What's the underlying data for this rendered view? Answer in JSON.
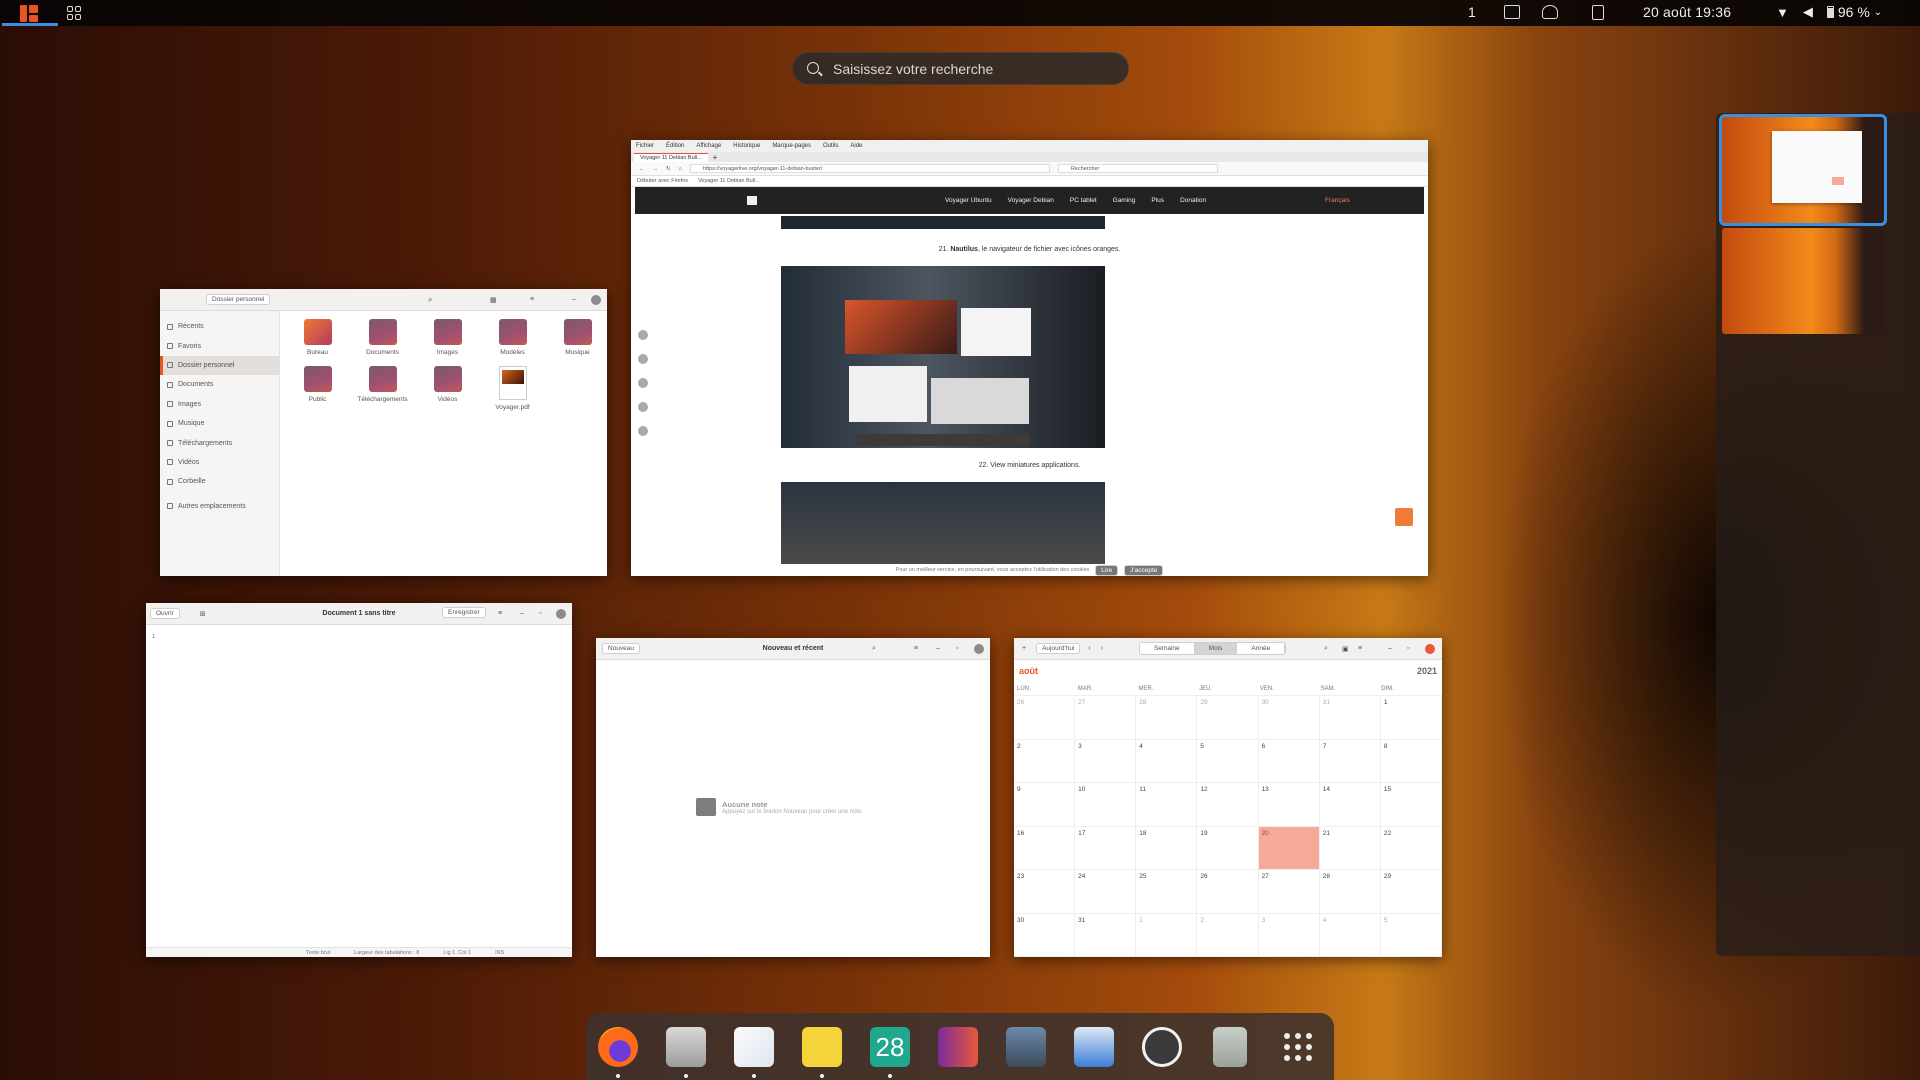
{
  "topbar": {
    "workspace_number": "1",
    "clock": "20 août 19:36",
    "battery": "96 %"
  },
  "search": {
    "placeholder": "Saisissez votre recherche"
  },
  "files_window": {
    "path": "Dossier personnel",
    "sidebar": [
      "Récents",
      "Favoris",
      "Dossier personnel",
      "Documents",
      "Images",
      "Musique",
      "Téléchargements",
      "Vidéos",
      "Corbeille",
      "Autres emplacements"
    ],
    "items": [
      "Bureau",
      "Documents",
      "Images",
      "Modèles",
      "Musique",
      "Public",
      "Téléchargements",
      "Vidéos",
      "Voyager.pdf"
    ]
  },
  "firefox_window": {
    "menu": [
      "Fichier",
      "Édition",
      "Affichage",
      "Historique",
      "Marque-pages",
      "Outils",
      "Aide"
    ],
    "tab_title": "Voyager 11 Debian Bull...",
    "url": "https://voyagerlive.org/voyager-11-debian-buster/",
    "search_placeholder": "Rechercher",
    "bookmarks": [
      "Débuter avec Firefox",
      "Voyager 11 Debian Bull..."
    ],
    "site_nav": [
      "Voyager Ubuntu",
      "Voyager Debian",
      "PC tablet",
      "Gaming",
      "Plus",
      "Donation"
    ],
    "language": "Français",
    "caption_21_num": "21.",
    "caption_21_bold": "Nautilus",
    "caption_21_rest": ", le navigateur de fichier avec icônes oranges.",
    "caption_22": "22. View miniatures applications.",
    "cookie_text": "Pour un meilleur service, en poursuivant, vous acceptez l'utilisation des cookies",
    "cookie_ok": "Lire",
    "cookie_accept": "J'accepte"
  },
  "editor_window": {
    "open_label": "Ouvrir",
    "title": "Document 1 sans titre",
    "save_label": "Enregistrer",
    "line_number": "1",
    "status": [
      "Texte brut",
      "Largeur des tabulations : 8",
      "Lig 1, Col 1",
      "INS"
    ]
  },
  "notes_window": {
    "new_label": "Nouveau",
    "title": "Nouveau et récent",
    "empty_title": "Aucune note",
    "empty_hint": "Appuyez sur le bouton Nouveau pour créer une note."
  },
  "calendar_window": {
    "today_label": "Aujourd'hui",
    "views": [
      "Semaine",
      "Mois",
      "Année"
    ],
    "month": "août",
    "year": "2021",
    "weekdays": [
      "LUN.",
      "MAR.",
      "MER.",
      "JEU.",
      "VEN.",
      "SAM.",
      "DIM."
    ],
    "cells": [
      "26",
      "27",
      "28",
      "29",
      "30",
      "31",
      "1",
      "2",
      "3",
      "4",
      "5",
      "6",
      "7",
      "8",
      "9",
      "10",
      "11",
      "12",
      "13",
      "14",
      "15",
      "16",
      "17",
      "18",
      "19",
      "20",
      "21",
      "22",
      "23",
      "24",
      "25",
      "26",
      "27",
      "28",
      "29",
      "30",
      "31",
      "1",
      "2",
      "3",
      "4",
      "5"
    ],
    "today": "20",
    "accent": "#f5a996"
  },
  "dock": {
    "apps": [
      "firefox-icon",
      "files-icon",
      "text-editor-icon",
      "notes-icon",
      "calendar-icon",
      "screenshot-icon",
      "terminal-icon",
      "software-store-icon",
      "record-icon",
      "trash-icon",
      "app-grid-icon"
    ],
    "calendar_day": "28"
  },
  "colors": {
    "accent": "#e95420",
    "selection": "#3b8fe0"
  }
}
